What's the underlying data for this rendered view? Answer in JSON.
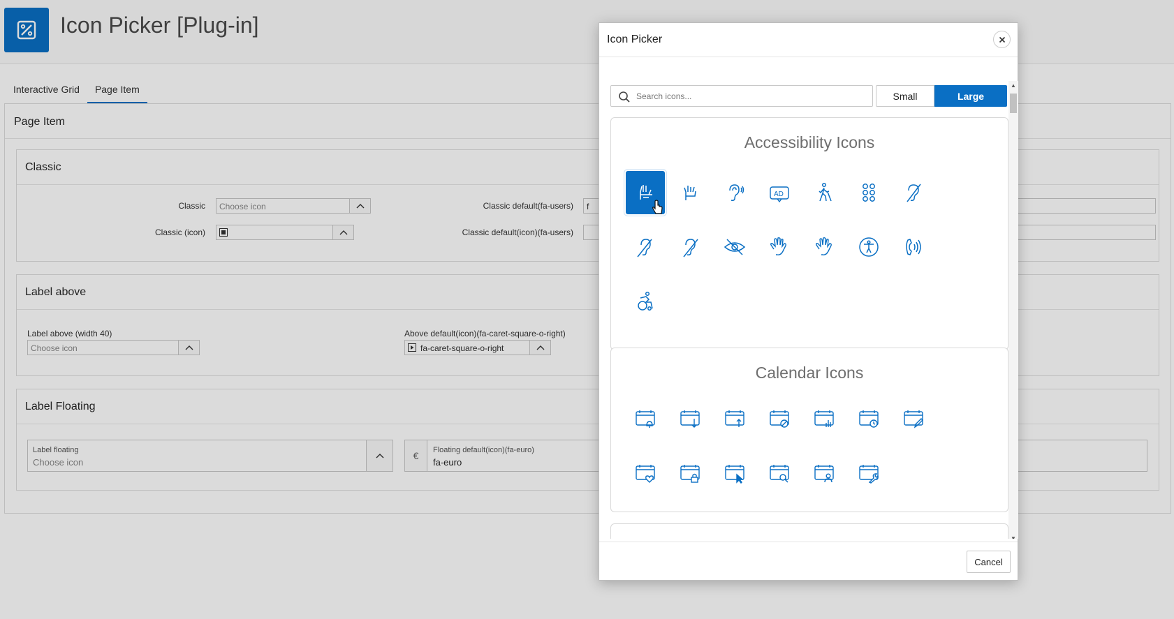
{
  "app": {
    "title": "Icon Picker [Plug-in]",
    "logo_icon": "plugin-logo-icon",
    "accent": "#0a6fc4"
  },
  "tabs": [
    {
      "label": "Interactive Grid",
      "active": false
    },
    {
      "label": "Page Item",
      "active": true
    }
  ],
  "region": {
    "title": "Page Item",
    "classic": {
      "title": "Classic",
      "classic_label": "Classic",
      "classic_placeholder": "Choose icon",
      "classic_icon_label": "Classic (icon)",
      "default_label": "Classic default(fa-users)",
      "default_value_initial": "f",
      "default_icon_label": "Classic default(icon)(fa-users)"
    },
    "label_above": {
      "title": "Label above",
      "field1_label": "Label above (width 40)",
      "field1_placeholder": "Choose icon",
      "field2_label": "Above default(icon)(fa-caret-square-o-right)",
      "field2_value": "fa-caret-square-o-right"
    },
    "label_floating": {
      "title": "Label Floating",
      "field1_label": "Label floating",
      "field1_placeholder": "Choose icon",
      "field2_prefix": "€",
      "field2_label": "Floating default(icon)(fa-euro)",
      "field2_value": "fa-euro"
    }
  },
  "dialog": {
    "title": "Icon Picker",
    "search_placeholder": "Search icons...",
    "size_options": [
      {
        "label": "Small",
        "selected": false
      },
      {
        "label": "Large",
        "selected": true
      }
    ],
    "groups": [
      {
        "title": "Accessibility Icons",
        "icons": [
          "american-sign-language-interpreting-icon",
          "asl-interpreting-icon",
          "assistive-listening-systems-icon",
          "audio-description-icon",
          "blind-icon",
          "braille-icon",
          "deaf-icon",
          "deafness-icon",
          "hard-of-hearing-icon",
          "low-vision-icon",
          "sign-language-icon",
          "signing-icon",
          "universal-access-icon",
          "volume-control-phone-icon",
          "wheelchair-alt-icon"
        ],
        "selected_index": 0
      },
      {
        "title": "Calendar Icons",
        "icons": [
          "calendar-alarm-icon",
          "calendar-arrow-down-icon",
          "calendar-arrow-up-icon",
          "calendar-ban-icon",
          "calendar-chart-icon",
          "calendar-clock-icon",
          "calendar-edit-icon",
          "calendar-heart-icon",
          "calendar-lock-icon",
          "calendar-pointer-icon",
          "calendar-search-icon",
          "calendar-user-icon",
          "calendar-wrench-icon"
        ]
      }
    ],
    "cancel_label": "Cancel"
  }
}
